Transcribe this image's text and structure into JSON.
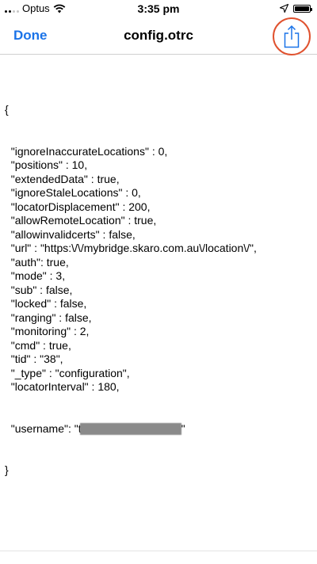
{
  "status_bar": {
    "carrier": "Optus",
    "time": "3:35 pm",
    "battery_level": 1.0
  },
  "nav": {
    "done_label": "Done",
    "title": "config.otrc",
    "share_icon": "share-icon"
  },
  "file": {
    "open_brace": "{",
    "lines": [
      "\"ignoreInaccurateLocations\" : 0,",
      "\"positions\" : 10,",
      "\"extendedData\" : true,",
      "\"ignoreStaleLocations\" : 0,",
      "\"locatorDisplacement\" : 200,",
      "\"allowRemoteLocation\" : true,",
      "\"allowinvalidcerts\" : false,",
      "\"url\" : \"https:\\/\\/mybridge.skaro.com.au\\/location\\/\",",
      "\"auth\": true,",
      "\"mode\" : 3,",
      "\"sub\" : false,",
      "\"locked\" : false,",
      "\"ranging\" : false,",
      "\"monitoring\" : 2,",
      "\"cmd\" : true,",
      "\"tid\" : \"38\",",
      "\"_type\" : \"configuration\",",
      "\"locatorInterval\" : 180,"
    ],
    "username_prefix": "\"username\": \"t",
    "username_suffix": "\"",
    "close_brace": "}"
  },
  "colors": {
    "accent": "#1a73e8",
    "highlight_ring": "#e0522f"
  }
}
